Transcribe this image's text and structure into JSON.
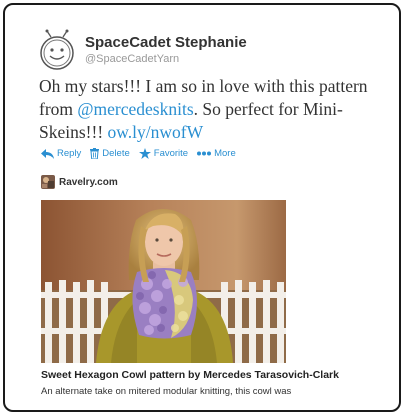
{
  "user": {
    "name": "SpaceCadet Stephanie",
    "handle": "@SpaceCadetYarn",
    "avatar_icon": "smiley-robot-avatar"
  },
  "tweet": {
    "text_before": "Oh my stars!!! I am so in love with this pattern from ",
    "mention": "@mercedesknits",
    "text_middle": ".  So perfect for Mini-Skeins!!! ",
    "link": "ow.ly/nwofW"
  },
  "actions": {
    "reply": "Reply",
    "delete": "Delete",
    "favorite": "Favorite",
    "more": "More"
  },
  "source": {
    "label": "Ravelry.com",
    "icon": "ravelry-favicon"
  },
  "card": {
    "image_icon": "woman-wearing-hexagon-cowl-photo",
    "title": "Sweet Hexagon Cowl pattern by Mercedes Tarasovich-Clark",
    "description": "An alternate take on mitered modular knitting, this cowl was"
  },
  "colors": {
    "link": "#2a8fd1",
    "text": "#333333",
    "handle": "#999999"
  }
}
